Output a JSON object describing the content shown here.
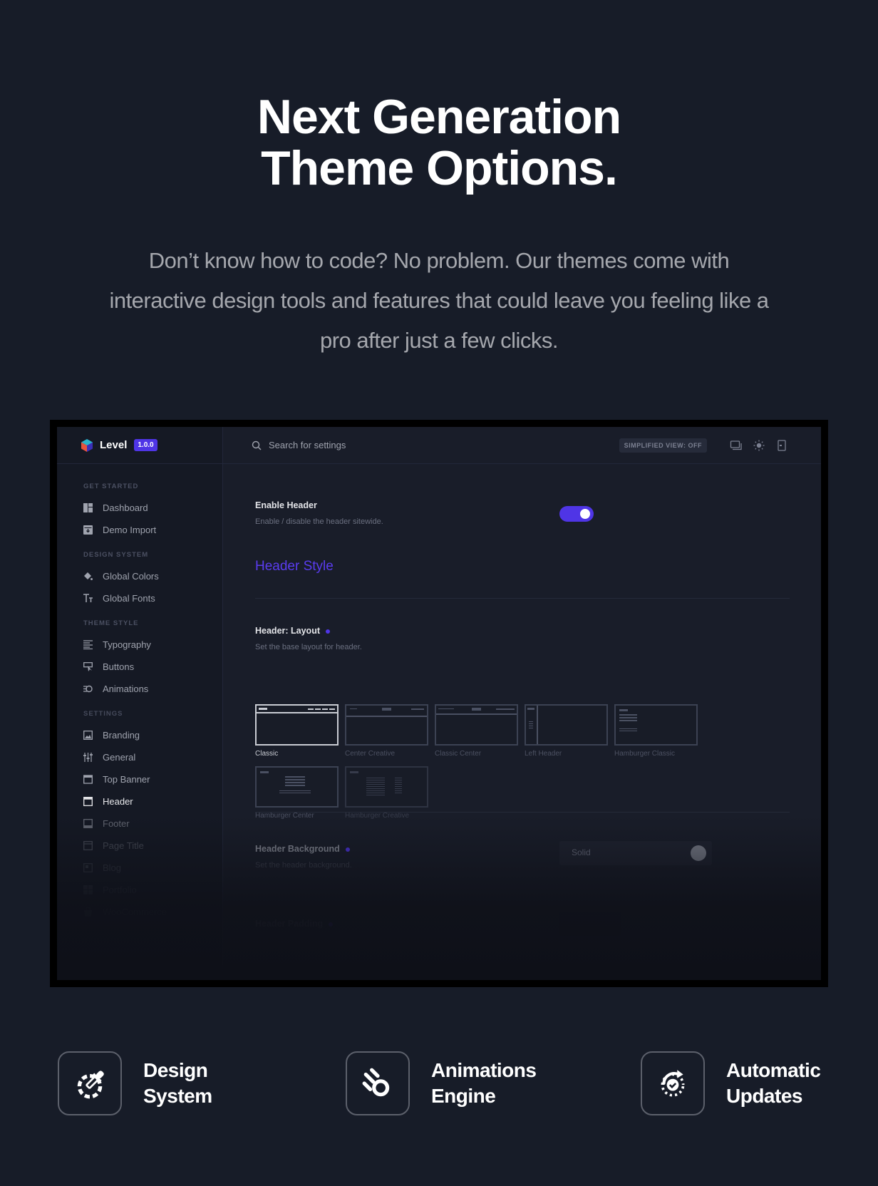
{
  "hero": {
    "title_line1": "Next Generation",
    "title_line2": "Theme Options.",
    "subtitle": "Don’t know how to code? No problem. Our themes come with interactive design tools and features that could leave you feeling like a pro after just a few clicks."
  },
  "app": {
    "brand": "Level",
    "version": "1.0.0",
    "accent": "#4f35e6",
    "search_placeholder": "Search for settings",
    "simplified_view": "SIMPLIFIED VIEW: OFF",
    "sidebar": {
      "sections": [
        {
          "title": "GET STARTED",
          "items": [
            {
              "label": "Dashboard",
              "icon": "dashboard-icon"
            },
            {
              "label": "Demo Import",
              "icon": "import-icon"
            }
          ]
        },
        {
          "title": "DESIGN SYSTEM",
          "items": [
            {
              "label": "Global Colors",
              "icon": "paint-bucket-icon"
            },
            {
              "label": "Global Fonts",
              "icon": "font-size-icon"
            }
          ]
        },
        {
          "title": "THEME STYLE",
          "items": [
            {
              "label": "Typography",
              "icon": "text-align-icon"
            },
            {
              "label": "Buttons",
              "icon": "cursor-click-icon"
            },
            {
              "label": "Animations",
              "icon": "animation-icon"
            }
          ]
        },
        {
          "title": "SETTINGS",
          "items": [
            {
              "label": "Branding",
              "icon": "image-icon"
            },
            {
              "label": "General",
              "icon": "sliders-icon"
            },
            {
              "label": "Top Banner",
              "icon": "top-banner-icon"
            },
            {
              "label": "Header",
              "icon": "header-icon",
              "active": true
            },
            {
              "label": "Footer",
              "icon": "footer-icon"
            },
            {
              "label": "Page Title",
              "icon": "page-title-icon"
            },
            {
              "label": "Blog",
              "icon": "blog-icon"
            },
            {
              "label": "Portfolio",
              "icon": "portfolio-icon"
            },
            {
              "label": "WooCommerce",
              "icon": "shop-icon"
            }
          ]
        }
      ]
    },
    "main": {
      "enable_header": {
        "label": "Enable Header",
        "description": "Enable / disable the header sitewide.",
        "value": true
      },
      "section_title": "Header Style",
      "layout": {
        "label": "Header: Layout",
        "description": "Set the base layout for header.",
        "selected": "Classic",
        "options": [
          "Classic",
          "Center Creative",
          "Classic Center",
          "Left Header",
          "Hamburger Classic",
          "Hamburger Center",
          "Hamburger Creative"
        ]
      },
      "background": {
        "label": "Header Background",
        "description": "Set the header background.",
        "value": "Solid"
      },
      "padding": {
        "label": "Header Padding"
      }
    }
  },
  "features": [
    {
      "line1": "Design",
      "line2": "System",
      "icon": "color-picker-icon"
    },
    {
      "line1": "Animations",
      "line2": "Engine",
      "icon": "comet-icon"
    },
    {
      "line1": "Automatic",
      "line2": "Updates",
      "icon": "refresh-check-icon"
    }
  ]
}
